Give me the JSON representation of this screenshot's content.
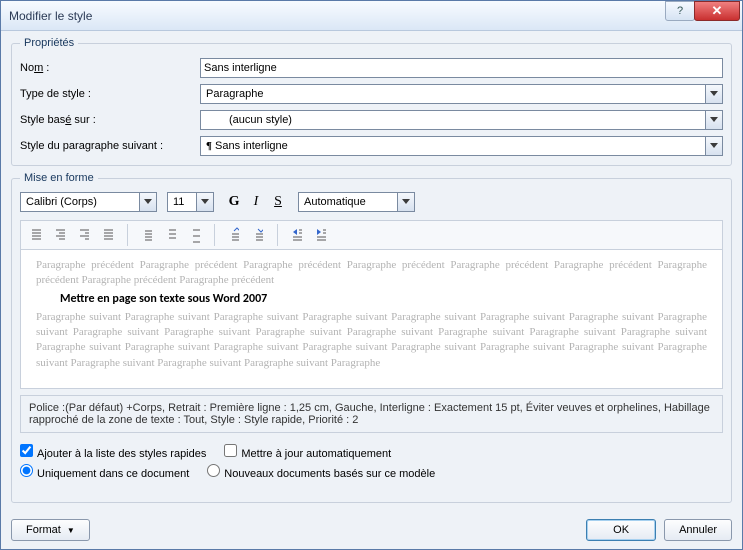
{
  "window": {
    "title": "Modifier le style"
  },
  "properties": {
    "legend": "Propriétés",
    "name_label_pre": "No",
    "name_label_u": "m",
    "name_label_post": " :",
    "name_value": "Sans interligne",
    "type_label": "Type de style :",
    "type_value": "Paragraphe",
    "based_label_pre": "Style bas",
    "based_label_u": "é",
    "based_label_post": " sur :",
    "based_value": "(aucun style)",
    "next_label": "Style du paragraphe suivant :",
    "next_value": "Sans interligne"
  },
  "formatting": {
    "legend": "Mise en forme",
    "font_name": "Calibri (Corps)",
    "font_size": "11",
    "bold": "G",
    "italic": "I",
    "underline": "S",
    "color_label": "Automatique"
  },
  "preview": {
    "before": "Paragraphe précédent Paragraphe précédent Paragraphe précédent Paragraphe précédent Paragraphe précédent Paragraphe précédent Paragraphe précédent Paragraphe précédent Paragraphe précédent",
    "sample": "Mettre en page son texte sous Word 2007",
    "after": "Paragraphe suivant Paragraphe suivant Paragraphe suivant Paragraphe suivant Paragraphe suivant Paragraphe suivant Paragraphe suivant Paragraphe suivant Paragraphe suivant Paragraphe suivant Paragraphe suivant Paragraphe suivant Paragraphe suivant Paragraphe suivant Paragraphe suivant Paragraphe suivant Paragraphe suivant Paragraphe suivant Paragraphe suivant Paragraphe suivant Paragraphe suivant Paragraphe suivant Paragraphe suivant Paragraphe suivant Paragraphe suivant Paragraphe suivant Paragraphe"
  },
  "description": "Police :(Par défaut) +Corps, Retrait : Première ligne : 1,25 cm, Gauche, Interligne : Exactement 15 pt, Éviter veuves et orphelines, Habillage rapproché de la zone de texte : Tout, Style : Style rapide, Priorité : 2",
  "checks": {
    "quick_styles": "Ajouter à la liste des styles rapides",
    "auto_update": "Mettre à jour automatiquement",
    "this_doc": "Uniquement dans ce document",
    "new_docs": "Nouveaux documents basés sur ce modèle"
  },
  "buttons": {
    "format": "Format",
    "ok": "OK",
    "cancel": "Annuler"
  }
}
